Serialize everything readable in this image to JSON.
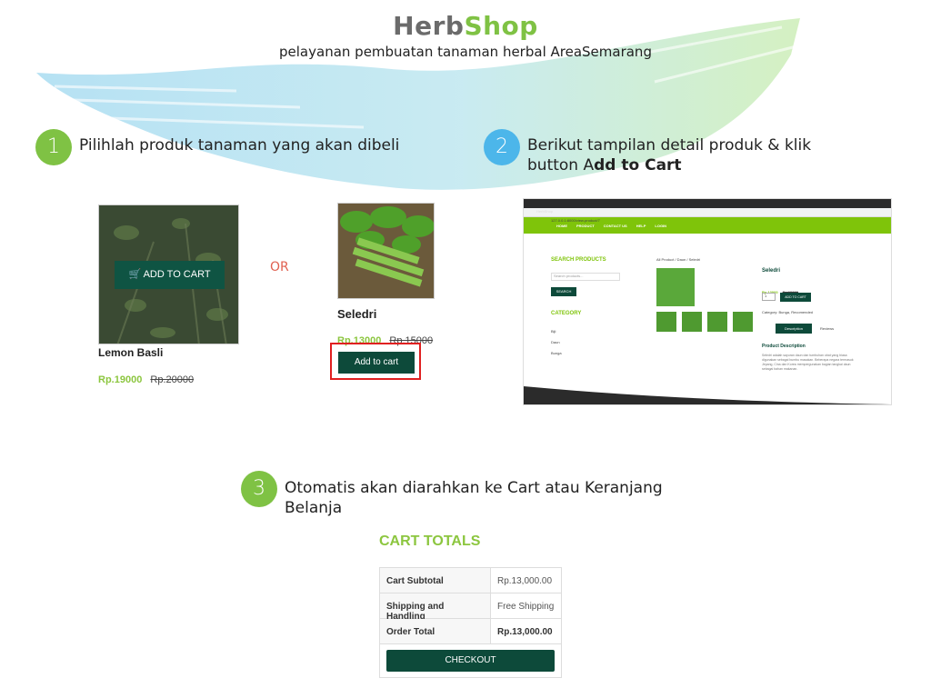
{
  "brand": {
    "part1": "Herb",
    "part2": "Shop"
  },
  "tagline": "pelayanan pembuatan tanaman herbal AreaSemarang",
  "colors": {
    "green": "#7fc244",
    "blue": "#4cb6ea",
    "dark_green": "#0d4a3a",
    "lime": "#7fc40a",
    "red_outline": "#e02020"
  },
  "steps": [
    {
      "number": "1",
      "text": "Pilihlah produk tanaman yang akan dibeli"
    },
    {
      "number": "2",
      "text_a": "Berikut tampilan detail produk & klik",
      "text_b": "button A",
      "text_bold": "dd to Cart"
    },
    {
      "number": "3",
      "text_a": "Otomatis akan diarahkan ke Cart atau Keranjang",
      "text_b": "Belanja"
    }
  ],
  "product1": {
    "overlay_button": "ADD TO CART",
    "icon": "cart-icon",
    "name": "Lemon Basli",
    "price": "Rp.19000",
    "old_price": "Rp.20000"
  },
  "or_text": "OR",
  "product2": {
    "name": "Seledri",
    "price": "Rp.13000",
    "old_price": "Rp.15000",
    "button": "Add to cart"
  },
  "browser": {
    "tab_title": "HerbShop",
    "address": "127.0.0.1:8000/view-product/7",
    "nav": [
      "HOME",
      "PRODUCT",
      "CONTACT US",
      "HELP",
      "LOGIN"
    ],
    "search_title": "SEARCH PRODUCTS",
    "search_placeholder": "Search products...",
    "search_button": "SEARCH",
    "category_title": "CATEGORY",
    "categories": [
      "Biji",
      "Daun",
      "Bunga"
    ],
    "breadcrumb": "All Product  /  Daun  /  Seledri",
    "product_name": "Seledri",
    "price": "Rp.13000",
    "old_price": "Rp.15000",
    "qty": "1",
    "add_button": "ADD TO CART",
    "category_line": "Category: Bunga, Recomended",
    "tabs": [
      "Description",
      "Reviews"
    ],
    "desc_title": "Product Description",
    "desc_text": "Seledri adalah sayuran daun dan tumbuhan obat yang biasa digunakan sebagai bumbu masakan. Beberapa negara termasuk Jepang, Cina dan Korea mempergunakan bagian tangkai daun sebagai bahan makanan."
  },
  "cart": {
    "title": "CART TOTALS",
    "rows": [
      {
        "label": "Cart Subtotal",
        "value": "Rp.13,000.00"
      },
      {
        "label": "Shipping and Handling",
        "value": "Free Shipping"
      },
      {
        "label": "Order Total",
        "value": "Rp.13,000.00"
      }
    ],
    "checkout": "CHECKOUT"
  }
}
